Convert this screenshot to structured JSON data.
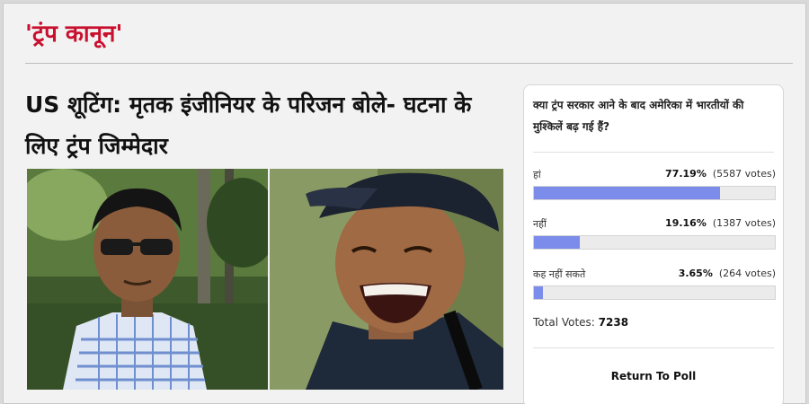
{
  "section": {
    "title": "'ट्रंप कानून'"
  },
  "article": {
    "headline": "US शूटिंग: मृतक इंजीनियर के परिजन बोले- घटना के लिए ट्रंप जिम्मेदार"
  },
  "images": [
    {
      "name": "photo-man-sunglasses"
    },
    {
      "name": "photo-man-cap-smiling"
    }
  ],
  "poll": {
    "question": "क्या ट्रंप सरकार आने के बाद अमेरिका में भारतीयों की मुश्किलें बढ़ गई हैं?",
    "options": [
      {
        "label": "हां",
        "percent_text": "77.19%",
        "votes_text": "(5587 votes)",
        "fraction": 0.7719
      },
      {
        "label": "नहीं",
        "percent_text": "19.16%",
        "votes_text": "(1387 votes)",
        "fraction": 0.1916
      },
      {
        "label": "कह नहीं सकते",
        "percent_text": "3.65%",
        "votes_text": "(264 votes)",
        "fraction": 0.0365
      }
    ],
    "total_label": "Total Votes:",
    "total_value": "7238",
    "return_label": "Return To Poll",
    "bar_color": "#7b8cea"
  },
  "colors": {
    "section_title": "#c8102e",
    "background": "#f2f2f2"
  }
}
